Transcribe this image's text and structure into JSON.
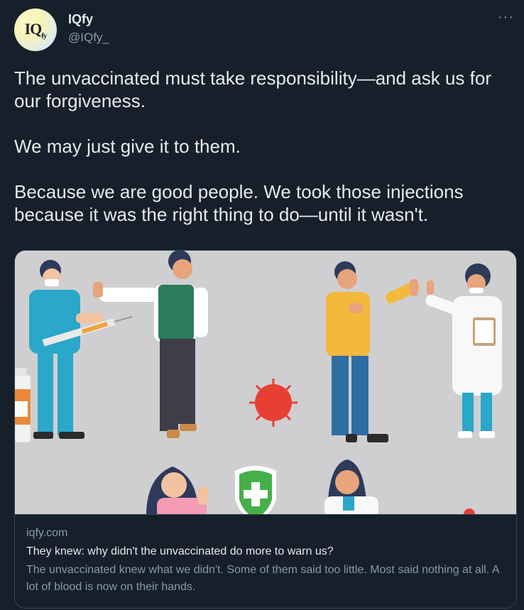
{
  "author": {
    "display_name": "IQfy",
    "handle": "@IQfy_",
    "avatar_text_main": "IQ",
    "avatar_text_sub": "fy"
  },
  "more_icon": "more-horizontal-icon",
  "tweet_text": "The unvaccinated must take responsibility—and ask us for our forgiveness.\n\nWe may just give it to them.\n\nBecause we are good people. We took those injections because it was the right thing to do—until it wasn't.",
  "link_card": {
    "domain": "iqfy.com",
    "title": "They knew: why didn't the unvaccinated do more to warn us?",
    "description": "The unvaccinated knew what we didn't. Some of them said too little. Most said nothing at all. A lot of blood is now on their hands."
  },
  "colors": {
    "background": "#15202b",
    "text_primary": "#e7e9ea",
    "text_secondary": "#8b98a5",
    "border": "#38444d",
    "image_background": "#cfcfd1"
  }
}
